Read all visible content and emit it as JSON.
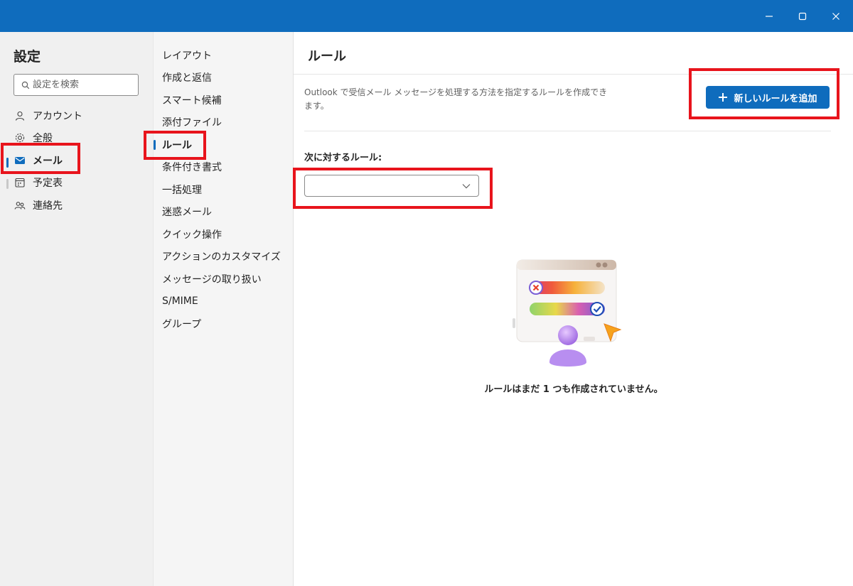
{
  "window": {
    "controls": [
      "minimize-icon",
      "maximize-icon",
      "close-icon"
    ],
    "accent": "#0f6cbd"
  },
  "sidebar": {
    "title": "設定",
    "search_placeholder": "設定を検索",
    "items": [
      {
        "label": "アカウント",
        "icon": "person-icon",
        "state": "normal"
      },
      {
        "label": "全般",
        "icon": "gear-icon",
        "state": "normal"
      },
      {
        "label": "メール",
        "icon": "mail-icon",
        "state": "selected"
      },
      {
        "label": "予定表",
        "icon": "calendar-icon",
        "state": "normal"
      },
      {
        "label": "連絡先",
        "icon": "people-icon",
        "state": "normal"
      }
    ]
  },
  "submenu": {
    "items": [
      {
        "label": "レイアウト",
        "state": "normal"
      },
      {
        "label": "作成と返信",
        "state": "normal"
      },
      {
        "label": "スマート候補",
        "state": "normal"
      },
      {
        "label": "添付ファイル",
        "state": "normal"
      },
      {
        "label": "ルール",
        "state": "selected"
      },
      {
        "label": "条件付き書式",
        "state": "normal"
      },
      {
        "label": "一括処理",
        "state": "normal"
      },
      {
        "label": "迷惑メール",
        "state": "normal"
      },
      {
        "label": "クイック操作",
        "state": "normal"
      },
      {
        "label": "アクションのカスタマイズ",
        "state": "normal"
      },
      {
        "label": "メッセージの取り扱い",
        "state": "normal"
      },
      {
        "label": "S/MIME",
        "state": "normal"
      },
      {
        "label": "グループ",
        "state": "normal"
      }
    ]
  },
  "main": {
    "title": "ルール",
    "description": "Outlook で受信メール メッセージを処理する方法を指定するルールを作成できます。",
    "add_button_label": "新しいルールを追加",
    "rules_for_label": "次に対するルール:",
    "rules_for_value": "",
    "empty_message": "ルールはまだ 1 つも作成されていません。"
  },
  "highlight_color": "#e8141c"
}
